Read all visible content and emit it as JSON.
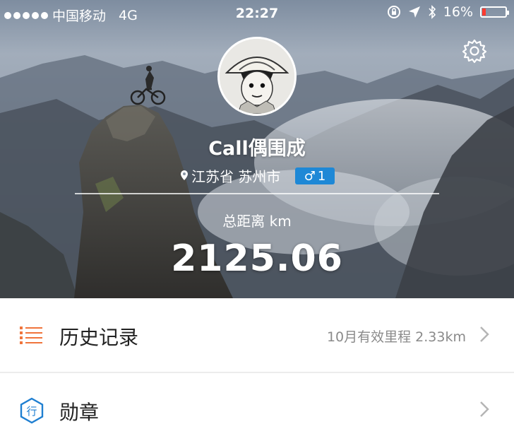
{
  "status_bar": {
    "carrier": "中国移动",
    "network": "4G",
    "time": "22:27",
    "battery": "16%",
    "battery_level": 0.16
  },
  "profile": {
    "username": "Call偶围成",
    "location": "江苏省 苏州市",
    "gender_symbol": "♂",
    "level": "1",
    "distance_label": "总距离 km",
    "distance_value": "2125.06"
  },
  "menu": {
    "history": {
      "label": "历史记录",
      "summary": "10月有效里程 2.33km"
    },
    "medals": {
      "label": "勋章",
      "icon_char": "行"
    }
  },
  "colors": {
    "accent_orange": "#f0743c",
    "badge_blue": "#1e88d6",
    "medal_blue": "#1f7fd1"
  },
  "icons": [
    "signal-dots-icon",
    "lock-rotation-icon",
    "location-arrow-icon",
    "bluetooth-icon",
    "battery-icon",
    "gear-icon",
    "pin-icon",
    "list-icon",
    "medal-icon",
    "chevron-right-icon"
  ]
}
